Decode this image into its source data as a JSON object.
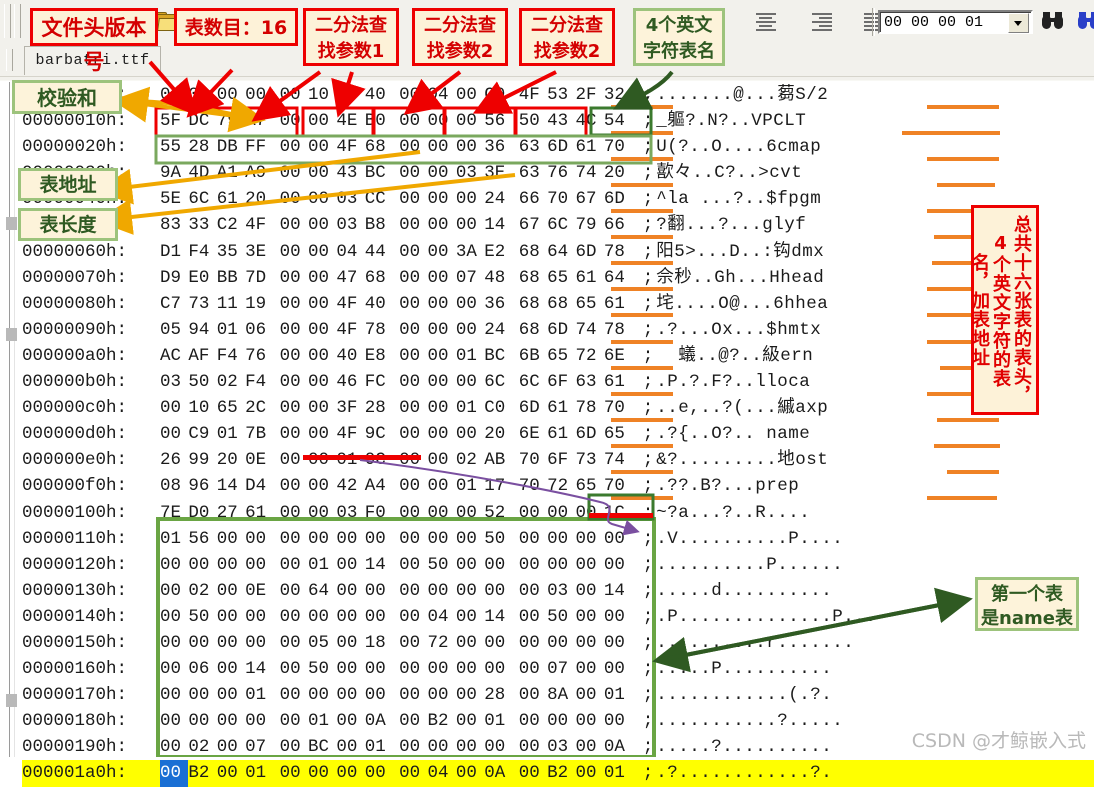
{
  "toolbar": {
    "offset_value": "00 00 00 01",
    "folder_icon": "open-folder-icon",
    "align_icons": [
      "align-left-icon",
      "align-center-icon",
      "align-right-icon",
      "align-justify-icon"
    ],
    "find_icon": "binoculars-icon",
    "find_next_icon": "binoculars-next-icon",
    "dropdown_icon": "chevron-down-icon"
  },
  "tab": {
    "filename": "barbatri.ttf"
  },
  "hex": {
    "rows": [
      {
        "addr": "00000000h",
        "bytes": [
          "00",
          "01",
          "00",
          "00",
          "00",
          "10",
          "00",
          "40",
          "00",
          "04",
          "00",
          "C0",
          "4F",
          "53",
          "2F",
          "32"
        ],
        "ascii": ".......@...蒭S/2"
      },
      {
        "addr": "00000010h",
        "bytes": [
          "5F",
          "DC",
          "79",
          "A7",
          "00",
          "00",
          "4E",
          "B0",
          "00",
          "00",
          "00",
          "56",
          "50",
          "43",
          "4C",
          "54"
        ],
        "ascii": "_軀?.N?..VPCLT"
      },
      {
        "addr": "00000020h",
        "bytes": [
          "55",
          "28",
          "DB",
          "FF",
          "00",
          "00",
          "4F",
          "68",
          "00",
          "00",
          "00",
          "36",
          "63",
          "6D",
          "61",
          "70"
        ],
        "ascii": "U(?..O....6cmap"
      },
      {
        "addr": "00000030h",
        "bytes": [
          "9A",
          "4D",
          "A1",
          "A9",
          "00",
          "00",
          "43",
          "BC",
          "00",
          "00",
          "03",
          "3E",
          "63",
          "76",
          "74",
          "20"
        ],
        "ascii": "歖々..C?..>cvt"
      },
      {
        "addr": "00000040h",
        "bytes": [
          "5E",
          "6C",
          "61",
          "20",
          "00",
          "00",
          "03",
          "CC",
          "00",
          "00",
          "00",
          "24",
          "66",
          "70",
          "67",
          "6D"
        ],
        "ascii": "^la ...?..$fpgm"
      },
      {
        "addr": "00000050h",
        "bytes": [
          "83",
          "33",
          "C2",
          "4F",
          "00",
          "00",
          "03",
          "B8",
          "00",
          "00",
          "00",
          "14",
          "67",
          "6C",
          "79",
          "66"
        ],
        "ascii": "?翻...?...glyf"
      },
      {
        "addr": "00000060h",
        "bytes": [
          "D1",
          "F4",
          "35",
          "3E",
          "00",
          "00",
          "04",
          "44",
          "00",
          "00",
          "3A",
          "E2",
          "68",
          "64",
          "6D",
          "78"
        ],
        "ascii": "阳5>...D..:钩dmx"
      },
      {
        "addr": "00000070h",
        "bytes": [
          "D9",
          "E0",
          "BB",
          "7D",
          "00",
          "00",
          "47",
          "68",
          "00",
          "00",
          "07",
          "48",
          "68",
          "65",
          "61",
          "64"
        ],
        "ascii": "佘秒..Gh...Hhead"
      },
      {
        "addr": "00000080h",
        "bytes": [
          "C7",
          "73",
          "11",
          "19",
          "00",
          "00",
          "4F",
          "40",
          "00",
          "00",
          "00",
          "36",
          "68",
          "68",
          "65",
          "61"
        ],
        "ascii": "垞....O@...6hhea"
      },
      {
        "addr": "00000090h",
        "bytes": [
          "05",
          "94",
          "01",
          "06",
          "00",
          "00",
          "4F",
          "78",
          "00",
          "00",
          "00",
          "24",
          "68",
          "6D",
          "74",
          "78"
        ],
        "ascii": ".?...Ox...$hmtx"
      },
      {
        "addr": "000000a0h",
        "bytes": [
          "AC",
          "AF",
          "F4",
          "76",
          "00",
          "00",
          "40",
          "E8",
          "00",
          "00",
          "01",
          "BC",
          "6B",
          "65",
          "72",
          "6E"
        ],
        "ascii": "  蟻..@?..級ern"
      },
      {
        "addr": "000000b0h",
        "bytes": [
          "03",
          "50",
          "02",
          "F4",
          "00",
          "00",
          "46",
          "FC",
          "00",
          "00",
          "00",
          "6C",
          "6C",
          "6F",
          "63",
          "61"
        ],
        "ascii": ".P.?.F?..lloca"
      },
      {
        "addr": "000000c0h",
        "bytes": [
          "00",
          "10",
          "65",
          "2C",
          "00",
          "00",
          "3F",
          "28",
          "00",
          "00",
          "01",
          "C0",
          "6D",
          "61",
          "78",
          "70"
        ],
        "ascii": "..e,..?(...縬axp"
      },
      {
        "addr": "000000d0h",
        "bytes": [
          "00",
          "C9",
          "01",
          "7B",
          "00",
          "00",
          "4F",
          "9C",
          "00",
          "00",
          "00",
          "20",
          "6E",
          "61",
          "6D",
          "65"
        ],
        "ascii": ".?{..O?.. name"
      },
      {
        "addr": "000000e0h",
        "bytes": [
          "26",
          "99",
          "20",
          "0E",
          "00",
          "00",
          "01",
          "0C",
          "00",
          "00",
          "02",
          "AB",
          "70",
          "6F",
          "73",
          "74"
        ],
        "ascii": "&?.........地ost"
      },
      {
        "addr": "000000f0h",
        "bytes": [
          "08",
          "96",
          "14",
          "D4",
          "00",
          "00",
          "42",
          "A4",
          "00",
          "00",
          "01",
          "17",
          "70",
          "72",
          "65",
          "70"
        ],
        "ascii": ".??.B?...prep"
      },
      {
        "addr": "00000100h",
        "bytes": [
          "7E",
          "D0",
          "27",
          "61",
          "00",
          "00",
          "03",
          "F0",
          "00",
          "00",
          "00",
          "52",
          "00",
          "00",
          "00",
          "1C"
        ],
        "ascii": "~?a...?..R...."
      },
      {
        "addr": "00000110h",
        "bytes": [
          "01",
          "56",
          "00",
          "00",
          "00",
          "00",
          "00",
          "00",
          "00",
          "00",
          "00",
          "50",
          "00",
          "00",
          "00",
          "00"
        ],
        "ascii": ".V..........P...."
      },
      {
        "addr": "00000120h",
        "bytes": [
          "00",
          "00",
          "00",
          "00",
          "00",
          "01",
          "00",
          "14",
          "00",
          "50",
          "00",
          "00",
          "00",
          "00",
          "00",
          "00"
        ],
        "ascii": "..........P......"
      },
      {
        "addr": "00000130h",
        "bytes": [
          "00",
          "02",
          "00",
          "0E",
          "00",
          "64",
          "00",
          "00",
          "00",
          "00",
          "00",
          "00",
          "00",
          "03",
          "00",
          "14"
        ],
        "ascii": ".....d.........."
      },
      {
        "addr": "00000140h",
        "bytes": [
          "00",
          "50",
          "00",
          "00",
          "00",
          "00",
          "00",
          "00",
          "00",
          "04",
          "00",
          "14",
          "00",
          "50",
          "00",
          "00"
        ],
        "ascii": ".P..............P..."
      },
      {
        "addr": "00000150h",
        "bytes": [
          "00",
          "00",
          "00",
          "00",
          "00",
          "05",
          "00",
          "18",
          "00",
          "72",
          "00",
          "00",
          "00",
          "00",
          "00",
          "00"
        ],
        "ascii": "..........r......."
      },
      {
        "addr": "00000160h",
        "bytes": [
          "00",
          "06",
          "00",
          "14",
          "00",
          "50",
          "00",
          "00",
          "00",
          "00",
          "00",
          "00",
          "00",
          "07",
          "00",
          "00"
        ],
        "ascii": ".....P.........."
      },
      {
        "addr": "00000170h",
        "bytes": [
          "00",
          "00",
          "00",
          "01",
          "00",
          "00",
          "00",
          "00",
          "00",
          "00",
          "00",
          "28",
          "00",
          "8A",
          "00",
          "01"
        ],
        "ascii": "............(.?."
      },
      {
        "addr": "00000180h",
        "bytes": [
          "00",
          "00",
          "00",
          "00",
          "00",
          "01",
          "00",
          "0A",
          "00",
          "B2",
          "00",
          "01",
          "00",
          "00",
          "00",
          "00"
        ],
        "ascii": "...........?....."
      },
      {
        "addr": "00000190h",
        "bytes": [
          "00",
          "02",
          "00",
          "07",
          "00",
          "BC",
          "00",
          "01",
          "00",
          "00",
          "00",
          "00",
          "00",
          "03",
          "00",
          "0A"
        ],
        "ascii": ".....?.........."
      },
      {
        "addr": "000001a0h",
        "bytes": [
          "00",
          "B2",
          "00",
          "01",
          "00",
          "00",
          "00",
          "00",
          "00",
          "04",
          "00",
          "0A",
          "00",
          "B2",
          "00",
          "01"
        ],
        "ascii": ".?............?."
      }
    ],
    "highlighted_row_index": 26,
    "selected_byte": {
      "row": 26,
      "index": 0
    }
  },
  "annotations": {
    "file_version": "文件头版本号",
    "table_count": "表数目：16",
    "binary_search_1": "二分法查\n找参数1",
    "binary_search_2": "二分法查\n找参数2",
    "binary_search_3": "二分法查\n找参数2",
    "table_name_4char": "4个英文\n字符表名",
    "checksum": "校验和",
    "table_address": "表地址",
    "table_length": "表长度",
    "sixteen_tables": "总共十六张表的表头，4个英文字符的表名，加表地址",
    "first_table_name": "第一个表\n是name表"
  },
  "watermark": "CSDN @才鲸嵌入式",
  "colors": {
    "red_box": "#ee0000",
    "green_box": "#9dc37c",
    "dark_green_box": "#3b7a2e",
    "annotation_bg": "#fdf2d8",
    "highlight": "#ffff00",
    "underline_orange": "#ef8225",
    "selection_blue": "#1a6fd4",
    "arrow_orange": "#f0a800",
    "arrow_red": "#ee0000",
    "arrow_purple": "#7a4fa0"
  }
}
